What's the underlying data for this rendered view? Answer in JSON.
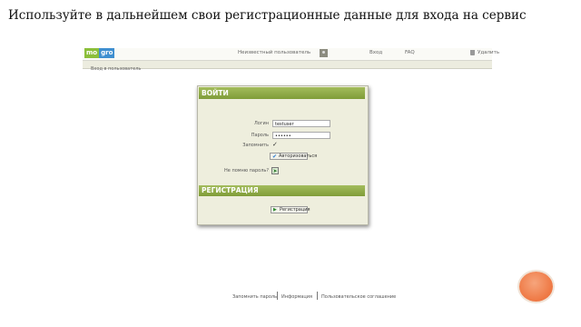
{
  "slide": {
    "title": "Используйте в дальнейшем свои регистрационные данные для входа на сервис"
  },
  "header": {
    "logo_part1": "mo",
    "logo_part2": "gro",
    "user_label": "Неизвестный пользователь",
    "link1": "Вход",
    "link2": "FAQ",
    "link3": "Удалить"
  },
  "breadcrumb": "Вход в пользователь",
  "login": {
    "section_title": "ВОЙТИ",
    "login_label": "Логин",
    "login_value": "testuser",
    "password_label": "Пароль",
    "password_value": "••••••",
    "remember_label": "Запомнить",
    "remember_checked": true,
    "submit_label": "Авторизоваться",
    "forgot_label": "Не помню пароль?"
  },
  "registration": {
    "section_title": "РЕГИСТРАЦИЯ",
    "button_label": "Регистрация"
  },
  "footer": {
    "link1": "Запомнить пароль",
    "link2": "Информация",
    "link3": "Пользовательское соглашение"
  },
  "colors": {
    "panel_header": "#8fab45",
    "panel_bg": "#eeeedd",
    "decor_circle": "#ef7a46"
  }
}
